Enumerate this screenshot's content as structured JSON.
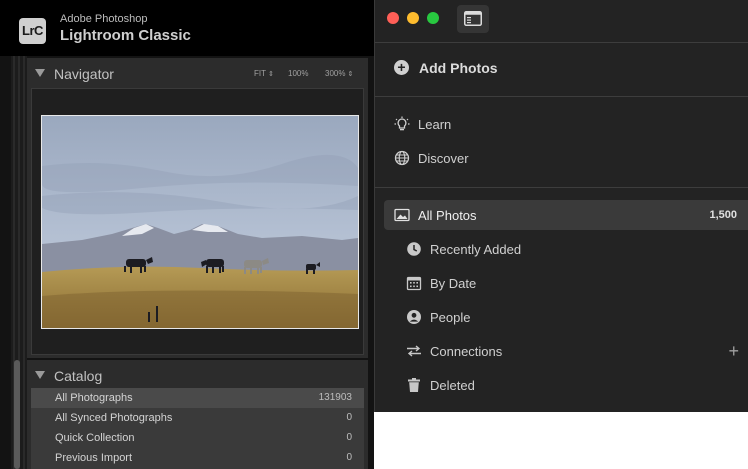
{
  "classic": {
    "brand_top": "Adobe Photoshop",
    "brand_name": "Lightroom Classic",
    "logo_text": "LrC",
    "navigator": {
      "title": "Navigator",
      "zoom_fit": "FIT",
      "zoom_100": "100%",
      "zoom_300": "300%"
    },
    "catalog": {
      "title": "Catalog",
      "rows": [
        {
          "label": "All Photographs",
          "count": "131903",
          "selected": true
        },
        {
          "label": "All Synced Photographs",
          "count": "0",
          "selected": false
        },
        {
          "label": "Quick Collection",
          "count": "0",
          "selected": false
        },
        {
          "label": "Previous Import",
          "count": "0",
          "selected": false
        }
      ]
    }
  },
  "cloud": {
    "add_photos": "Add Photos",
    "learn": "Learn",
    "discover": "Discover",
    "all_photos": {
      "label": "All Photos",
      "count": "1,500"
    },
    "items": [
      {
        "label": "Recently Added",
        "icon": "clock-icon"
      },
      {
        "label": "By Date",
        "icon": "calendar-icon"
      },
      {
        "label": "People",
        "icon": "person-icon"
      },
      {
        "label": "Connections",
        "icon": "connections-icon"
      },
      {
        "label": "Deleted",
        "icon": "trash-icon"
      }
    ],
    "connections_add": "+"
  },
  "colors": {
    "close": "#ff5f57",
    "minimize": "#febc2e",
    "zoom": "#28c840",
    "classic_bg": "#131313",
    "cloud_bg": "#232323"
  }
}
